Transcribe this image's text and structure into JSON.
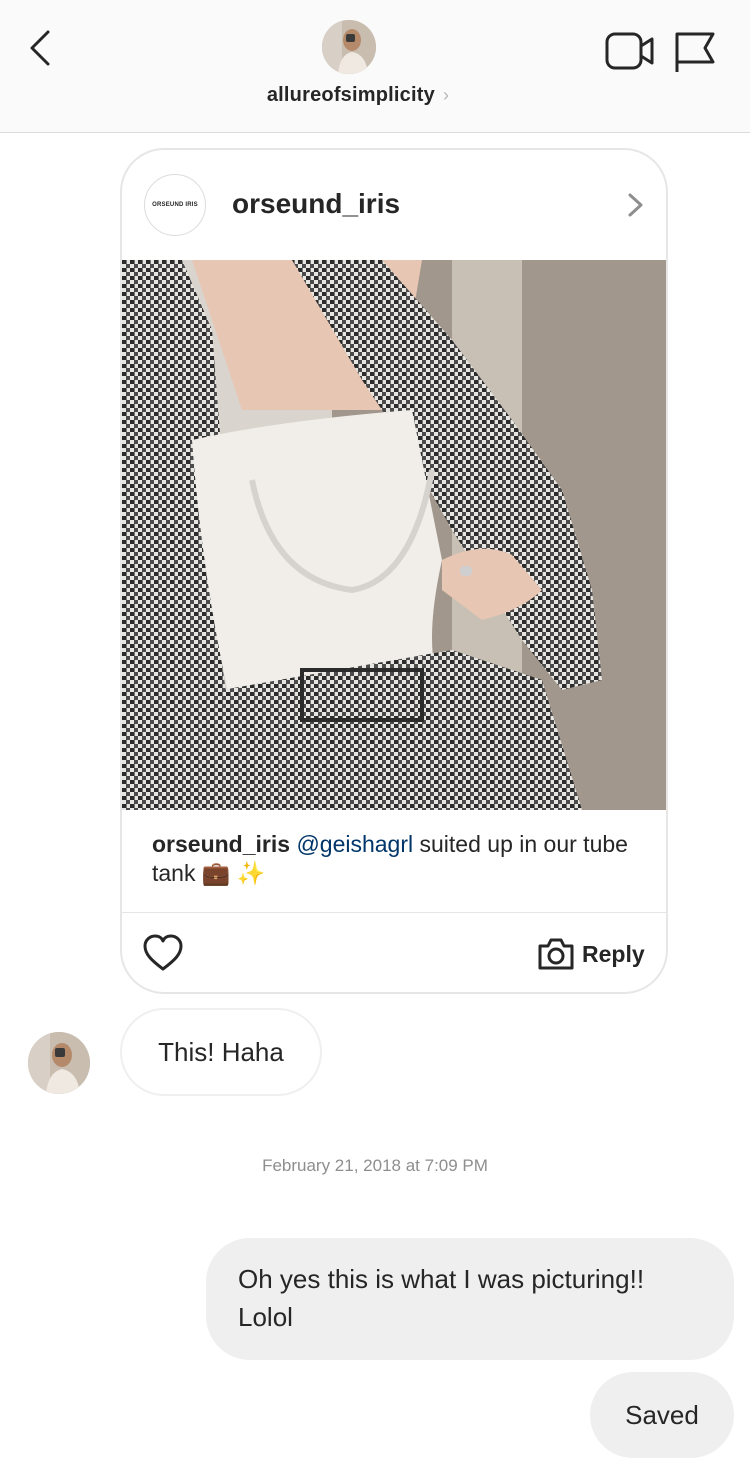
{
  "header": {
    "username": "allureofsimplicity",
    "chevron": "›",
    "icons": {
      "back": "chevron-left-icon",
      "video": "video-camera-icon",
      "flag": "flag-icon"
    }
  },
  "shared_post": {
    "brand_logo_text": "ORSEUND IRIS",
    "username": "orseund_iris",
    "caption_user": "orseund_iris",
    "caption_mention": "@geishagrl",
    "caption_text": "suited up in our tube tank",
    "caption_emoji": "💼 ✨",
    "reply_label": "Reply"
  },
  "messages": [
    {
      "direction": "incoming",
      "text": "This! Haha"
    },
    {
      "direction": "outgoing",
      "text": "Oh yes this is what I was picturing!! Lolol"
    },
    {
      "direction": "outgoing",
      "text": "Saved"
    }
  ],
  "timestamp": "February 21, 2018 at 7:09 PM",
  "colors": {
    "header_bg": "#fafafa",
    "bubble_gray": "#efefef",
    "mention": "#003569",
    "muted": "#8e8e8e"
  }
}
